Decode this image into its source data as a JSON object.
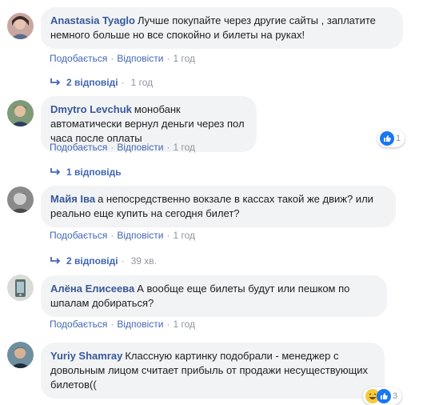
{
  "comments": [
    {
      "author": "Anastasia Tyaglo",
      "text": "Лучше покупайте через другие сайты , заплатите немного больше но все спокойно и билеты на руках!",
      "like_label": "Подобається",
      "reply_label": "Відповісти",
      "time": "1 год",
      "replies_label": "2 відповіді",
      "replies_time": "1 год"
    },
    {
      "author": "Dmytro Levchuk",
      "text": "монобанк автоматически вернул деньги через пол часа после оплаты",
      "like_label": "Подобається",
      "reply_label": "Відповісти",
      "time": "1 год",
      "reaction_count": "1",
      "replies_label": "1 відповідь"
    },
    {
      "author": "Майя Іва",
      "text": "а непосредственно вокзале в кассах такой же движ? или реально еще купить на сегодня билет?",
      "like_label": "Подобається",
      "reply_label": "Відповісти",
      "time": "1 год",
      "replies_label": "2 відповіді",
      "replies_time": "39 хв."
    },
    {
      "author": "Алёна Елисеева",
      "text": "А вообще еще билеты будут или пешком по шпалам добираться?",
      "like_label": "Подобається",
      "reply_label": "Відповісти",
      "time": "1 год"
    },
    {
      "author": "Yuriy Shamray",
      "text": "Классную картинку подобрали - менеджер с довольным лицом считает прибыль от продажи несуществующих билетов((",
      "reaction_count": "3"
    }
  ],
  "colors": {
    "link": "#4267b2",
    "author": "#385898",
    "bubble": "#f2f3f5",
    "meta": "#90949c",
    "like": "#1877f2"
  },
  "icons": [
    "reply-arrow-icon",
    "like-reaction-icon",
    "haha-reaction-icon"
  ]
}
